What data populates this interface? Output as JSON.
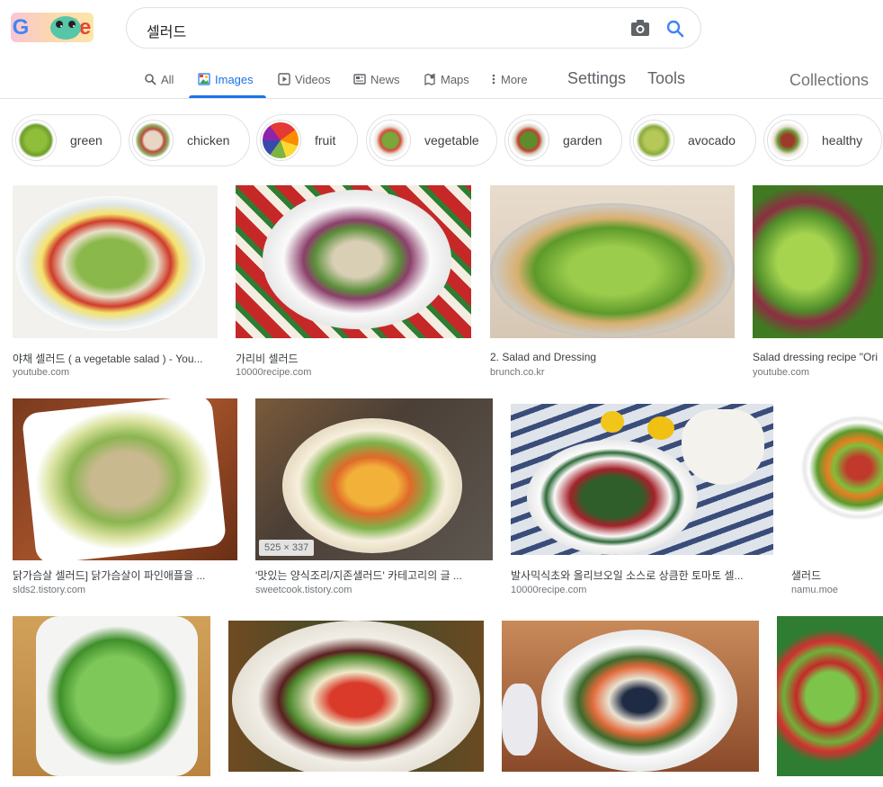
{
  "search": {
    "query": "셀러드"
  },
  "tabs": [
    {
      "label": "All",
      "icon": "search-icon"
    },
    {
      "label": "Images",
      "icon": "image-icon",
      "active": true
    },
    {
      "label": "Videos",
      "icon": "play-icon"
    },
    {
      "label": "News",
      "icon": "newspaper-icon"
    },
    {
      "label": "Maps",
      "icon": "map-pin-icon"
    },
    {
      "label": "More",
      "icon": "dots-vertical-icon"
    }
  ],
  "links": {
    "settings": "Settings",
    "tools": "Tools",
    "collections": "Collections"
  },
  "chips": [
    {
      "label": "green"
    },
    {
      "label": "chicken"
    },
    {
      "label": "fruit"
    },
    {
      "label": "vegetable"
    },
    {
      "label": "garden"
    },
    {
      "label": "avocado"
    },
    {
      "label": "healthy"
    }
  ],
  "results": [
    {
      "title": "야채 셀러드 ( a vegetable salad ) - You...",
      "source": "youtube.com"
    },
    {
      "title": "가리비 셀러드",
      "source": "10000recipe.com"
    },
    {
      "title": "2. Salad and Dressing",
      "source": "brunch.co.kr"
    },
    {
      "title": "Salad dressing recipe \"Ori",
      "source": "youtube.com"
    },
    {
      "title": "닭가슴살 셀러드] 닭가슴살이 파인애플을 ...",
      "source": "slds2.tistory.com"
    },
    {
      "title": "'맛있는 양식조리/지존샐러드' 카테고리의 글 ...",
      "source": "sweetcook.tistory.com"
    },
    {
      "title": "발사믹식초와 올리브오일 소스로 상큼한 토마토 셀...",
      "source": "10000recipe.com"
    },
    {
      "title": "샐러드",
      "source": "namu.moe"
    }
  ],
  "hover_dimensions": "525 × 337",
  "colors": {
    "accent": "#1a73e8",
    "text_secondary": "#5f6368",
    "border": "#dfe1e5"
  }
}
